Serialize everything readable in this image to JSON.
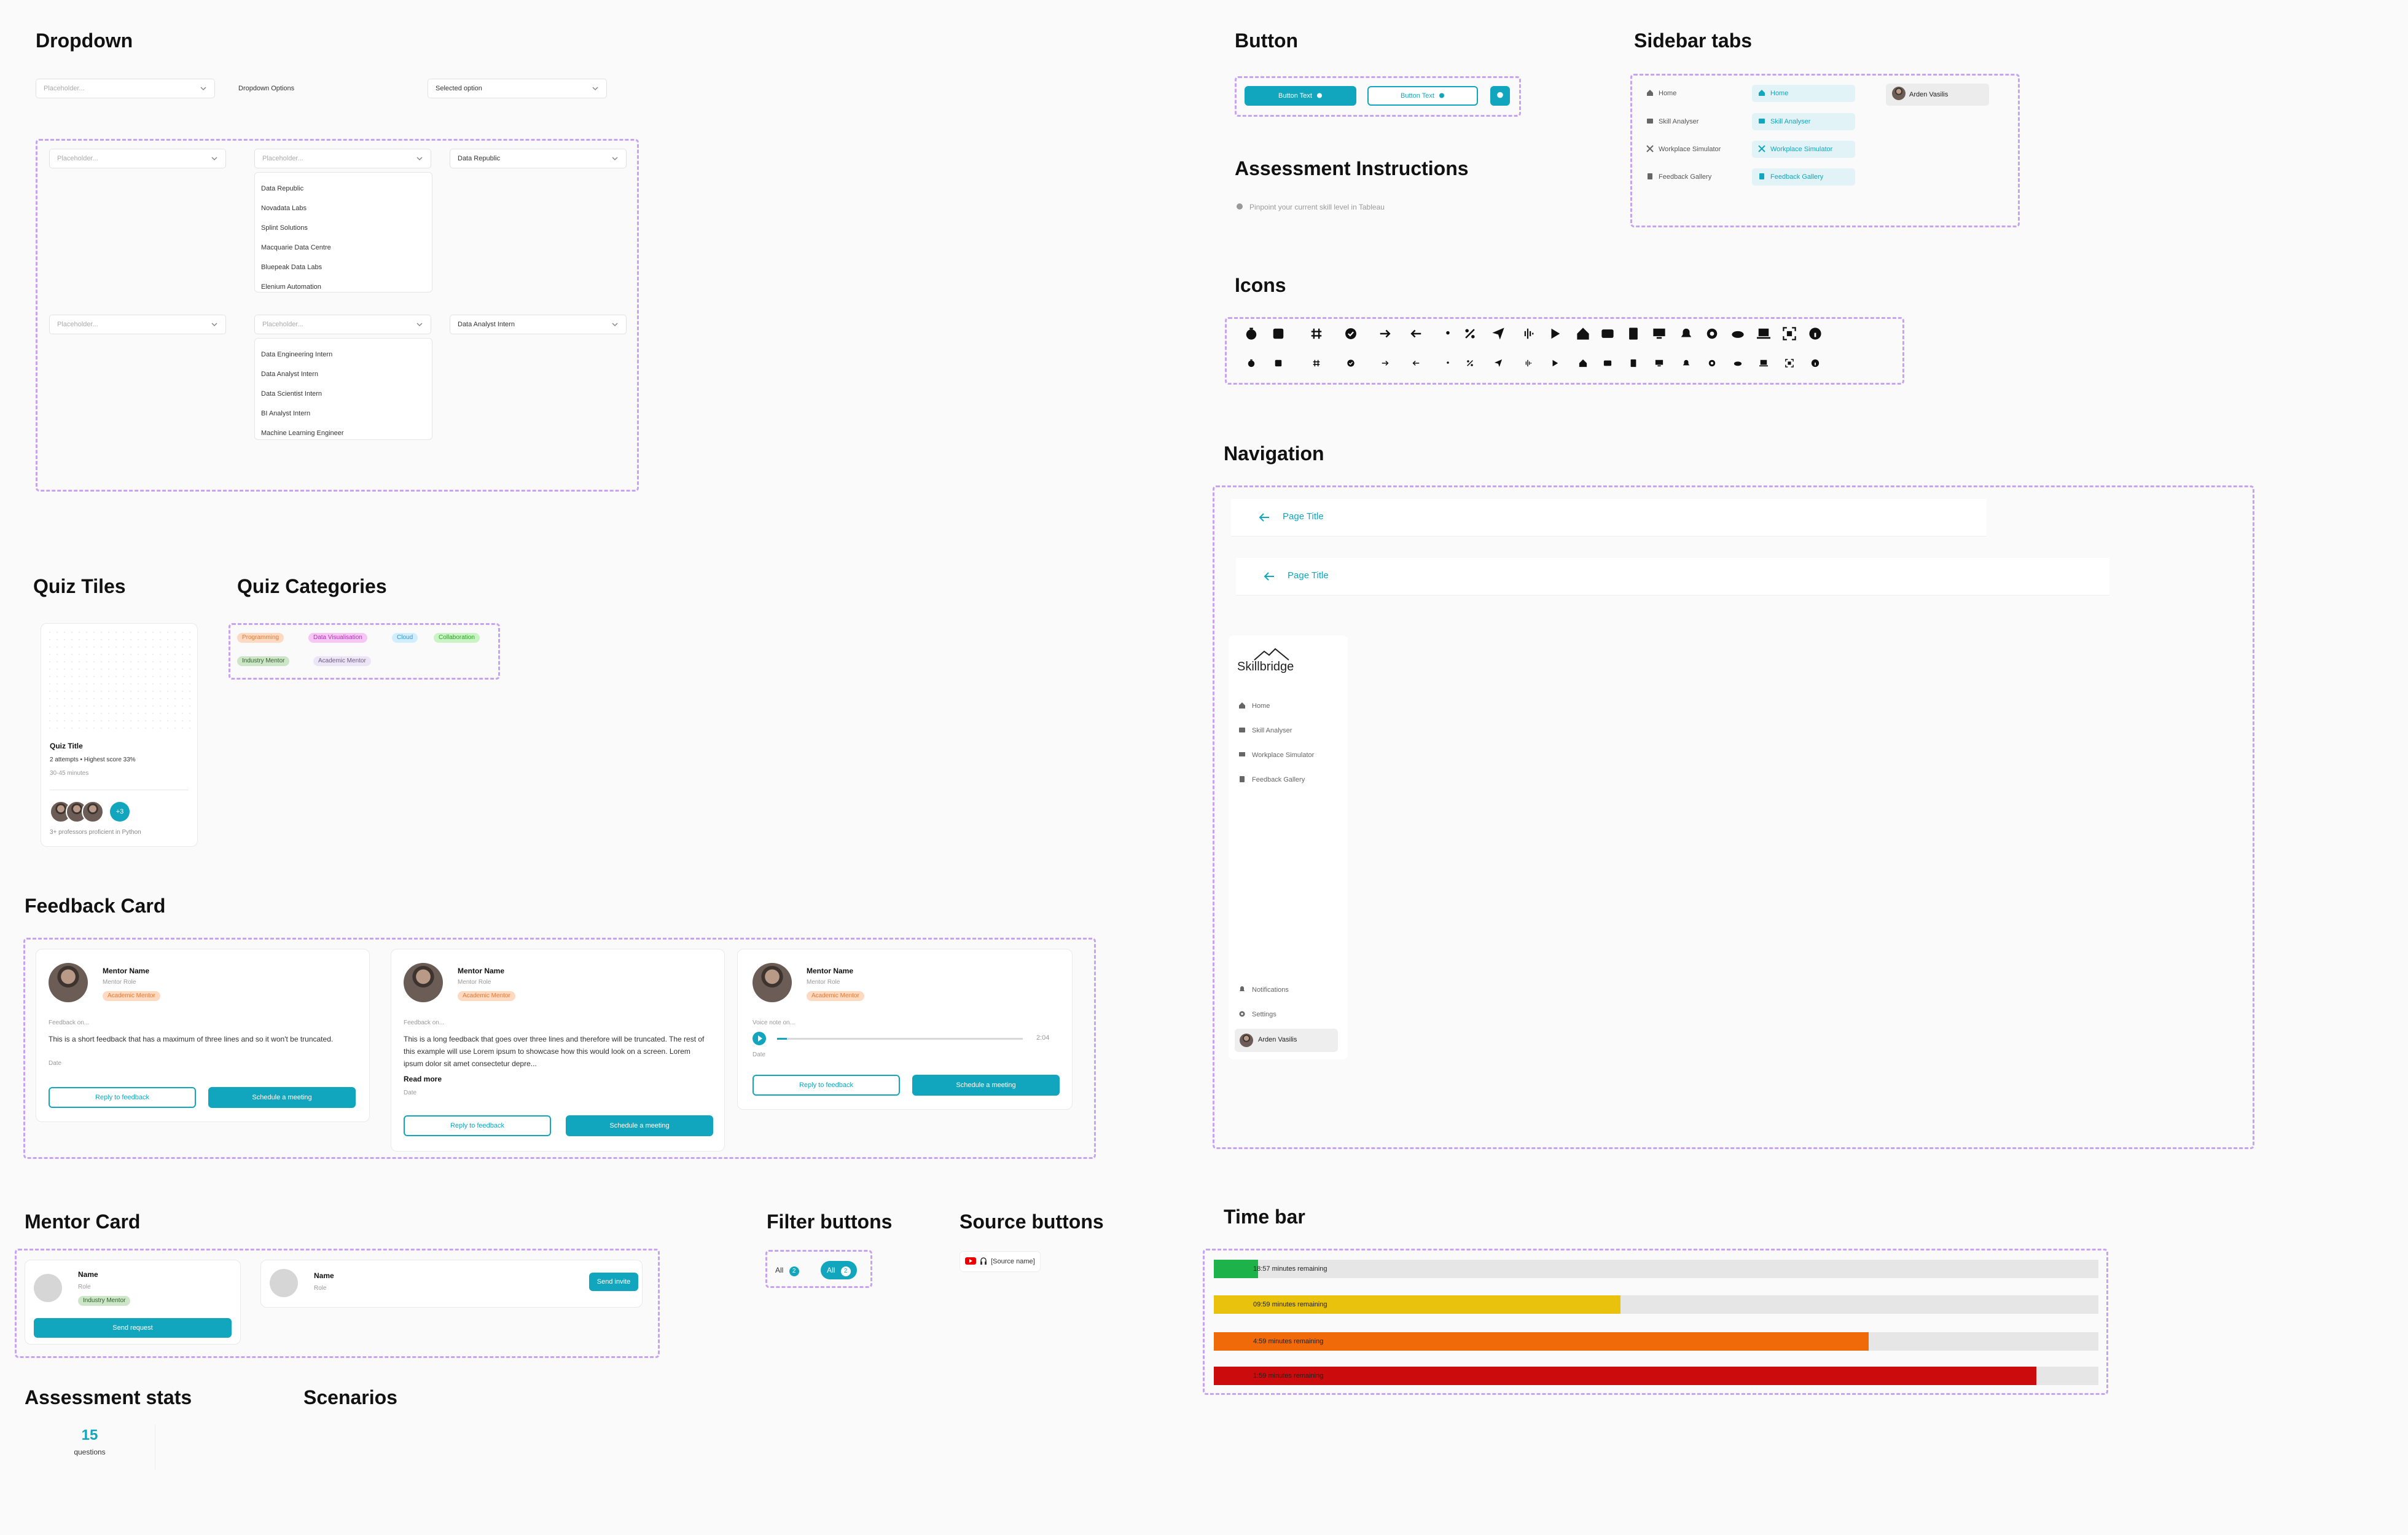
{
  "dropdown": {
    "title": "Dropdown",
    "top": {
      "placeholder": "Placeholder...",
      "options_label": "Dropdown Options",
      "selected": "Selected option"
    },
    "companies": {
      "placeholder1": "Placeholder...",
      "placeholder2": "Placeholder...",
      "selected": "Data Republic",
      "options": [
        "Data Republic",
        "Novadata Labs",
        "Splint Solutions",
        "Macquarie Data Centre",
        "Bluepeak Data Labs",
        "Elenium Automation"
      ]
    },
    "roles": {
      "placeholder1": "Placeholder...",
      "placeholder2": "Placeholder...",
      "selected": "Data Analyst Intern",
      "options": [
        "Data Engineering Intern",
        "Data Analyst Intern",
        "Data Scientist Intern",
        "BI Analyst Intern",
        "Machine Learning Engineer"
      ]
    }
  },
  "button": {
    "title": "Button",
    "filled_label": "Button Text",
    "outline_label": "Button Text"
  },
  "assessment_instructions": {
    "title": "Assessment Instructions",
    "item": "Pinpoint your current skill level in Tableau"
  },
  "sidebar_tabs": {
    "title": "Sidebar tabs",
    "items": [
      "Home",
      "Skill Analyser",
      "Workplace Simulator",
      "Feedback Gallery"
    ],
    "user": "Arden Vasilis"
  },
  "icons": {
    "title": "Icons"
  },
  "navigation": {
    "title": "Navigation",
    "page_title_1": "Page Title",
    "page_title_2": "Page Title",
    "logo_text": "Skillbridge",
    "items": [
      "Home",
      "Skill Analyser",
      "Workplace Simulator",
      "Feedback Gallery"
    ],
    "bottom_items": [
      "Notifications",
      "Settings"
    ],
    "user": "Arden Vasilis"
  },
  "quiz_tiles": {
    "title": "Quiz Tiles",
    "quiz_title": "Quiz Title",
    "meta": "2 attempts • Highest score 33%",
    "duration": "30-45 minutes",
    "extra_count": "+3",
    "footer": "3+ professors proficient in Python"
  },
  "quiz_categories": {
    "title": "Quiz Categories",
    "chips": [
      "Programming",
      "Data Visualisation",
      "Cloud",
      "Collaboration",
      "Industry Mentor",
      "Academic Mentor"
    ]
  },
  "feedback_card": {
    "title": "Feedback Card",
    "mentor_name": "Mentor Name",
    "mentor_role": "Mentor Role",
    "badge": "Academic Mentor",
    "feedback_on": "Feedback on...",
    "short_text": "This is a short feedback that has a maximum of three lines and so it won't be truncated.",
    "long_text": "This is a long feedback that goes over three lines and therefore will be truncated. The rest of this example will use Lorem ipsum to showcase how this would look on a screen. Lorem ipsum dolor sit amet consectetur depre...",
    "read_more": "Read more",
    "date": "Date",
    "voice_label": "Voice note on...",
    "duration": "2:04",
    "reply": "Reply to feedback",
    "schedule": "Schedule a meeting"
  },
  "mentor_card": {
    "title": "Mentor Card",
    "name": "Name",
    "role": "Role",
    "badge": "Industry Mentor",
    "send_request": "Send request",
    "send_invite": "Send invite"
  },
  "filter_buttons": {
    "title": "Filter buttons",
    "label": "All",
    "count": "2"
  },
  "source_buttons": {
    "title": "Source buttons",
    "label": "[Source name]"
  },
  "assessment_stats": {
    "title": "Assessment stats",
    "value": "15",
    "unit": "questions"
  },
  "scenarios": {
    "title": "Scenarios"
  },
  "time_bar": {
    "title": "Time bar",
    "bars": [
      {
        "label": "18:57 minutes remaining",
        "fraction": 0.05,
        "color": "#1db34a"
      },
      {
        "label": "09:59 minutes remaining",
        "fraction": 0.46,
        "color": "#e8c20c"
      },
      {
        "label": "4:59 minutes remaining",
        "fraction": 0.74,
        "color": "#f06a0a"
      },
      {
        "label": "1:59 minutes remaining",
        "fraction": 0.93,
        "color": "#cc0c0c"
      }
    ]
  },
  "colors": {
    "accent": "#11a6be",
    "dashed_border": "#c7a3f2"
  }
}
